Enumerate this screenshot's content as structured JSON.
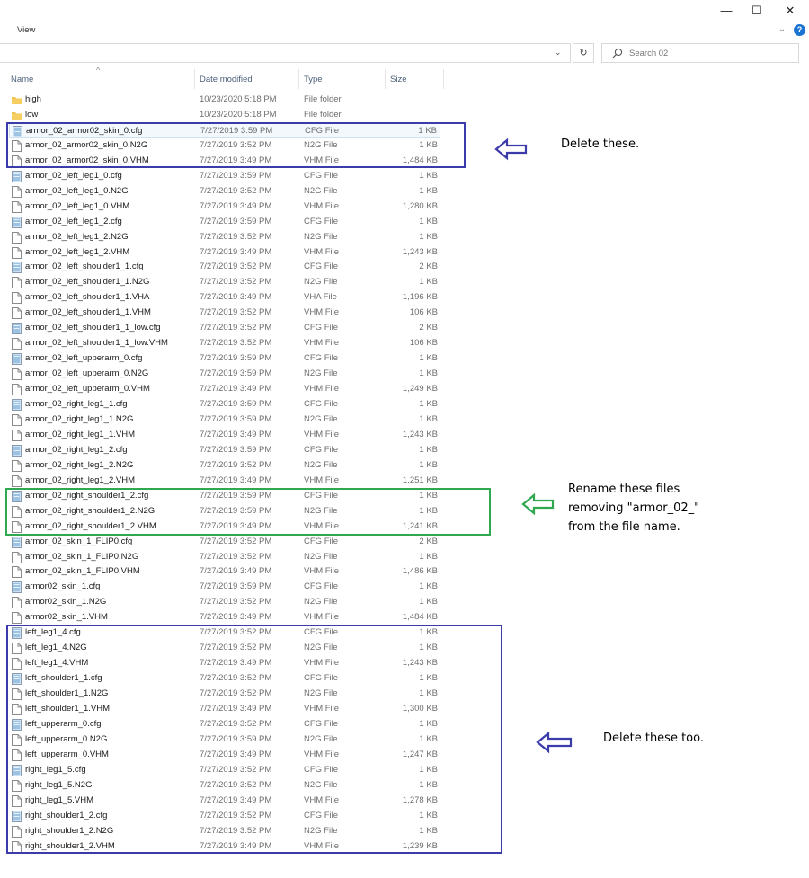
{
  "window": {
    "minimize_glyph": "—",
    "maximize_glyph": "☐",
    "close_glyph": "✕",
    "menu_view": "View",
    "help_glyph": "?"
  },
  "toolbar": {
    "refresh_glyph": "↻",
    "search_placeholder": "Search 02",
    "address_chevron": "⌄"
  },
  "columns": {
    "name": "Name",
    "date": "Date modified",
    "type": "Type",
    "size": "Size"
  },
  "files": [
    {
      "name": "high",
      "date": "10/23/2020 5:18 PM",
      "type": "File folder",
      "size": "",
      "icon": "folder-icon"
    },
    {
      "name": "low",
      "date": "10/23/2020 5:18 PM",
      "type": "File folder",
      "size": "",
      "icon": "folder-icon"
    },
    {
      "name": "armor_02_armor02_skin_0.cfg",
      "date": "7/27/2019 3:59 PM",
      "type": "CFG File",
      "size": "1 KB",
      "icon": "config-file-icon"
    },
    {
      "name": "armor_02_armor02_skin_0.N2G",
      "date": "7/27/2019 3:52 PM",
      "type": "N2G File",
      "size": "1 KB",
      "icon": "file-icon"
    },
    {
      "name": "armor_02_armor02_skin_0.VHM",
      "date": "7/27/2019 3:49 PM",
      "type": "VHM File",
      "size": "1,484 KB",
      "icon": "file-icon"
    },
    {
      "name": "armor_02_left_leg1_0.cfg",
      "date": "7/27/2019 3:59 PM",
      "type": "CFG File",
      "size": "1 KB",
      "icon": "config-file-icon"
    },
    {
      "name": "armor_02_left_leg1_0.N2G",
      "date": "7/27/2019 3:52 PM",
      "type": "N2G File",
      "size": "1 KB",
      "icon": "file-icon"
    },
    {
      "name": "armor_02_left_leg1_0.VHM",
      "date": "7/27/2019 3:49 PM",
      "type": "VHM File",
      "size": "1,280 KB",
      "icon": "file-icon"
    },
    {
      "name": "armor_02_left_leg1_2.cfg",
      "date": "7/27/2019 3:59 PM",
      "type": "CFG File",
      "size": "1 KB",
      "icon": "config-file-icon"
    },
    {
      "name": "armor_02_left_leg1_2.N2G",
      "date": "7/27/2019 3:52 PM",
      "type": "N2G File",
      "size": "1 KB",
      "icon": "file-icon"
    },
    {
      "name": "armor_02_left_leg1_2.VHM",
      "date": "7/27/2019 3:49 PM",
      "type": "VHM File",
      "size": "1,243 KB",
      "icon": "file-icon"
    },
    {
      "name": "armor_02_left_shoulder1_1.cfg",
      "date": "7/27/2019 3:52 PM",
      "type": "CFG File",
      "size": "2 KB",
      "icon": "config-file-icon"
    },
    {
      "name": "armor_02_left_shoulder1_1.N2G",
      "date": "7/27/2019 3:52 PM",
      "type": "N2G File",
      "size": "1 KB",
      "icon": "file-icon"
    },
    {
      "name": "armor_02_left_shoulder1_1.VHA",
      "date": "7/27/2019 3:49 PM",
      "type": "VHA File",
      "size": "1,196 KB",
      "icon": "file-icon"
    },
    {
      "name": "armor_02_left_shoulder1_1.VHM",
      "date": "7/27/2019 3:52 PM",
      "type": "VHM File",
      "size": "106 KB",
      "icon": "file-icon"
    },
    {
      "name": "armor_02_left_shoulder1_1_low.cfg",
      "date": "7/27/2019 3:52 PM",
      "type": "CFG File",
      "size": "2 KB",
      "icon": "config-file-icon"
    },
    {
      "name": "armor_02_left_shoulder1_1_low.VHM",
      "date": "7/27/2019 3:52 PM",
      "type": "VHM File",
      "size": "106 KB",
      "icon": "file-icon"
    },
    {
      "name": "armor_02_left_upperarm_0.cfg",
      "date": "7/27/2019 3:59 PM",
      "type": "CFG File",
      "size": "1 KB",
      "icon": "config-file-icon"
    },
    {
      "name": "armor_02_left_upperarm_0.N2G",
      "date": "7/27/2019 3:59 PM",
      "type": "N2G File",
      "size": "1 KB",
      "icon": "file-icon"
    },
    {
      "name": "armor_02_left_upperarm_0.VHM",
      "date": "7/27/2019 3:49 PM",
      "type": "VHM File",
      "size": "1,249 KB",
      "icon": "file-icon"
    },
    {
      "name": "armor_02_right_leg1_1.cfg",
      "date": "7/27/2019 3:59 PM",
      "type": "CFG File",
      "size": "1 KB",
      "icon": "config-file-icon"
    },
    {
      "name": "armor_02_right_leg1_1.N2G",
      "date": "7/27/2019 3:59 PM",
      "type": "N2G File",
      "size": "1 KB",
      "icon": "file-icon"
    },
    {
      "name": "armor_02_right_leg1_1.VHM",
      "date": "7/27/2019 3:49 PM",
      "type": "VHM File",
      "size": "1,243 KB",
      "icon": "file-icon"
    },
    {
      "name": "armor_02_right_leg1_2.cfg",
      "date": "7/27/2019 3:59 PM",
      "type": "CFG File",
      "size": "1 KB",
      "icon": "config-file-icon"
    },
    {
      "name": "armor_02_right_leg1_2.N2G",
      "date": "7/27/2019 3:52 PM",
      "type": "N2G File",
      "size": "1 KB",
      "icon": "file-icon"
    },
    {
      "name": "armor_02_right_leg1_2.VHM",
      "date": "7/27/2019 3:49 PM",
      "type": "VHM File",
      "size": "1,251 KB",
      "icon": "file-icon"
    },
    {
      "name": "armor_02_right_shoulder1_2.cfg",
      "date": "7/27/2019 3:59 PM",
      "type": "CFG File",
      "size": "1 KB",
      "icon": "config-file-icon"
    },
    {
      "name": "armor_02_right_shoulder1_2.N2G",
      "date": "7/27/2019 3:59 PM",
      "type": "N2G File",
      "size": "1 KB",
      "icon": "file-icon"
    },
    {
      "name": "armor_02_right_shoulder1_2.VHM",
      "date": "7/27/2019 3:49 PM",
      "type": "VHM File",
      "size": "1,241 KB",
      "icon": "file-icon"
    },
    {
      "name": "armor_02_skin_1_FLIP0.cfg",
      "date": "7/27/2019 3:52 PM",
      "type": "CFG File",
      "size": "2 KB",
      "icon": "config-file-icon"
    },
    {
      "name": "armor_02_skin_1_FLIP0.N2G",
      "date": "7/27/2019 3:52 PM",
      "type": "N2G File",
      "size": "1 KB",
      "icon": "file-icon"
    },
    {
      "name": "armor_02_skin_1_FLIP0.VHM",
      "date": "7/27/2019 3:49 PM",
      "type": "VHM File",
      "size": "1,486 KB",
      "icon": "file-icon"
    },
    {
      "name": "armor02_skin_1.cfg",
      "date": "7/27/2019 3:59 PM",
      "type": "CFG File",
      "size": "1 KB",
      "icon": "config-file-icon"
    },
    {
      "name": "armor02_skin_1.N2G",
      "date": "7/27/2019 3:52 PM",
      "type": "N2G File",
      "size": "1 KB",
      "icon": "file-icon"
    },
    {
      "name": "armor02_skin_1.VHM",
      "date": "7/27/2019 3:49 PM",
      "type": "VHM File",
      "size": "1,484 KB",
      "icon": "file-icon"
    },
    {
      "name": "left_leg1_4.cfg",
      "date": "7/27/2019 3:52 PM",
      "type": "CFG File",
      "size": "1 KB",
      "icon": "config-file-icon"
    },
    {
      "name": "left_leg1_4.N2G",
      "date": "7/27/2019 3:52 PM",
      "type": "N2G File",
      "size": "1 KB",
      "icon": "file-icon"
    },
    {
      "name": "left_leg1_4.VHM",
      "date": "7/27/2019 3:49 PM",
      "type": "VHM File",
      "size": "1,243 KB",
      "icon": "file-icon"
    },
    {
      "name": "left_shoulder1_1.cfg",
      "date": "7/27/2019 3:52 PM",
      "type": "CFG File",
      "size": "1 KB",
      "icon": "config-file-icon"
    },
    {
      "name": "left_shoulder1_1.N2G",
      "date": "7/27/2019 3:52 PM",
      "type": "N2G File",
      "size": "1 KB",
      "icon": "file-icon"
    },
    {
      "name": "left_shoulder1_1.VHM",
      "date": "7/27/2019 3:49 PM",
      "type": "VHM File",
      "size": "1,300 KB",
      "icon": "file-icon"
    },
    {
      "name": "left_upperarm_0.cfg",
      "date": "7/27/2019 3:52 PM",
      "type": "CFG File",
      "size": "1 KB",
      "icon": "config-file-icon"
    },
    {
      "name": "left_upperarm_0.N2G",
      "date": "7/27/2019 3:59 PM",
      "type": "N2G File",
      "size": "1 KB",
      "icon": "file-icon"
    },
    {
      "name": "left_upperarm_0.VHM",
      "date": "7/27/2019 3:49 PM",
      "type": "VHM File",
      "size": "1,247 KB",
      "icon": "file-icon"
    },
    {
      "name": "right_leg1_5.cfg",
      "date": "7/27/2019 3:52 PM",
      "type": "CFG File",
      "size": "1 KB",
      "icon": "config-file-icon"
    },
    {
      "name": "right_leg1_5.N2G",
      "date": "7/27/2019 3:52 PM",
      "type": "N2G File",
      "size": "1 KB",
      "icon": "file-icon"
    },
    {
      "name": "right_leg1_5.VHM",
      "date": "7/27/2019 3:49 PM",
      "type": "VHM File",
      "size": "1,278 KB",
      "icon": "file-icon"
    },
    {
      "name": "right_shoulder1_2.cfg",
      "date": "7/27/2019 3:52 PM",
      "type": "CFG File",
      "size": "1 KB",
      "icon": "config-file-icon"
    },
    {
      "name": "right_shoulder1_2.N2G",
      "date": "7/27/2019 3:52 PM",
      "type": "N2G File",
      "size": "1 KB",
      "icon": "file-icon"
    },
    {
      "name": "right_shoulder1_2.VHM",
      "date": "7/27/2019 3:49 PM",
      "type": "VHM File",
      "size": "1,239 KB",
      "icon": "file-icon"
    }
  ],
  "annotations": {
    "delete_first": "Delete these.",
    "rename_line1": "Rename these files",
    "rename_line2": "removing \"armor_02_\"",
    "rename_line3": "from the file name.",
    "delete_second": "Delete these too.",
    "delete_color": "#3b3baa",
    "rename_color": "#2fa84f"
  },
  "colors": {
    "folder": "#f2c14e",
    "header_text": "#4c607a",
    "help_blue": "#1a73d1"
  }
}
